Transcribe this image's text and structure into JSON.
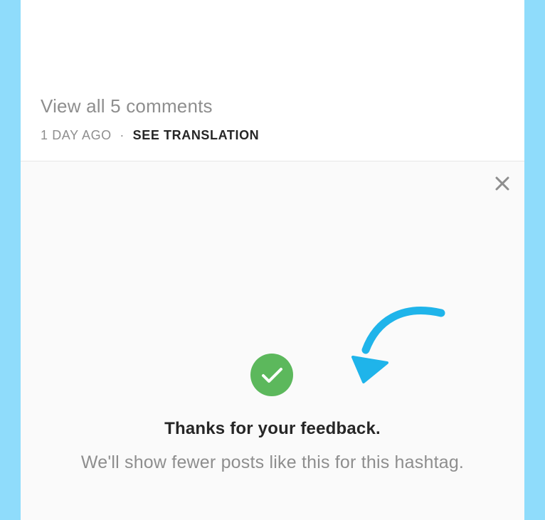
{
  "post": {
    "view_comments": "View all 5 comments",
    "timestamp": "1 DAY AGO",
    "separator": "·",
    "translate_label": "SEE TRANSLATION"
  },
  "feedback": {
    "title": "Thanks for your feedback.",
    "message": "We'll show fewer posts like this for this hashtag."
  },
  "icons": {
    "close": "close-icon",
    "check": "check-circle-icon",
    "arrow": "curved-arrow-annotation"
  },
  "colors": {
    "background": "#8fdcfb",
    "check_green": "#5cb85c",
    "arrow_blue": "#1fb4ea",
    "muted_text": "#8e8e8e",
    "dark_text": "#262626"
  }
}
